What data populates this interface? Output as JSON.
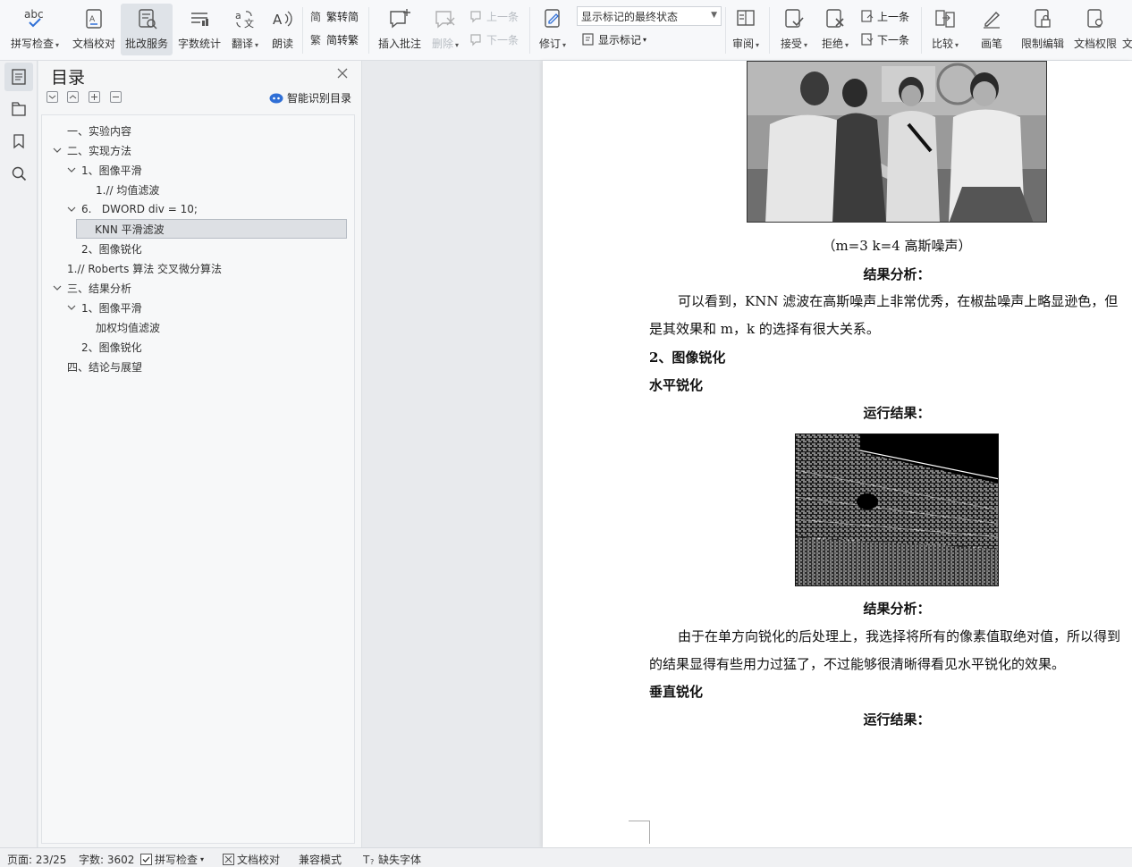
{
  "ribbon": {
    "spell_check": "拼写检查",
    "doc_proof": "文档校对",
    "review_service": "批改服务",
    "word_count": "字数统计",
    "translate": "翻译",
    "read_aloud": "朗读",
    "trad_to_simp": "繁转简",
    "simp_to_trad": "简转繁",
    "insert_comment": "插入批注",
    "delete": "删除",
    "prev_comment": "上一条",
    "next_comment": "下一条",
    "track_changes": "修订",
    "markup_state": "显示标记的最终状态",
    "show_markup": "显示标记",
    "review_pane": "审阅",
    "accept": "接受",
    "reject": "拒绝",
    "prev_change": "上一条",
    "next_change": "下一条",
    "compare": "比较",
    "ink": "画笔",
    "restrict_edit": "限制编辑",
    "doc_permission": "文档权限",
    "overflow": "文"
  },
  "toc": {
    "title": "目录",
    "smart_label": "智能识别目录",
    "items": [
      {
        "text": "一、实验内容"
      },
      {
        "text": "二、实现方法"
      },
      {
        "text": "1、图像平滑"
      },
      {
        "text": "1.// 均值滤波"
      },
      {
        "text": "6.   DWORD div = 10;"
      },
      {
        "text": "KNN 平滑滤波"
      },
      {
        "text": "2、图像锐化"
      },
      {
        "text": "1.// Roberts 算法 交叉微分算法"
      },
      {
        "text": "三、结果分析"
      },
      {
        "text": "1、图像平滑"
      },
      {
        "text": "加权均值滤波"
      },
      {
        "text": "2、图像锐化"
      },
      {
        "text": "四、结论与展望"
      }
    ]
  },
  "doc": {
    "caption1": "（m=3 k=4  高斯噪声）",
    "analysis_heading1": "结果分析：",
    "para1_line1": "可以看到，KNN 滤波在高斯噪声上非常优秀，在椒盐噪声上略显逊色，但",
    "para1_line2": "是其效果和 m，k 的选择有很大关系。",
    "section_sharpen": "2、图像锐化",
    "horizontal_sharpen": "水平锐化",
    "run_result1": "运行结果：",
    "analysis_heading2": "结果分析：",
    "para2_line1": "由于在单方向锐化的后处理上，我选择将所有的像素值取绝对值，所以得到",
    "para2_line2": "的结果显得有些用力过猛了，不过能够很清晰得看见水平锐化的效果。",
    "vertical_sharpen": "垂直锐化",
    "run_result2": "运行结果："
  },
  "status": {
    "page": "页面: 23/25",
    "word_count": "字数: 3602",
    "spell_check": "拼写检查",
    "doc_proof": "文档校对",
    "compat_mode": "兼容模式",
    "missing_fonts": "缺失字体"
  },
  "colors": {
    "accent_blue": "#2f6fd6",
    "toolbar_bg": "#f7f8fa",
    "selected_toc": "#dde0e4"
  }
}
